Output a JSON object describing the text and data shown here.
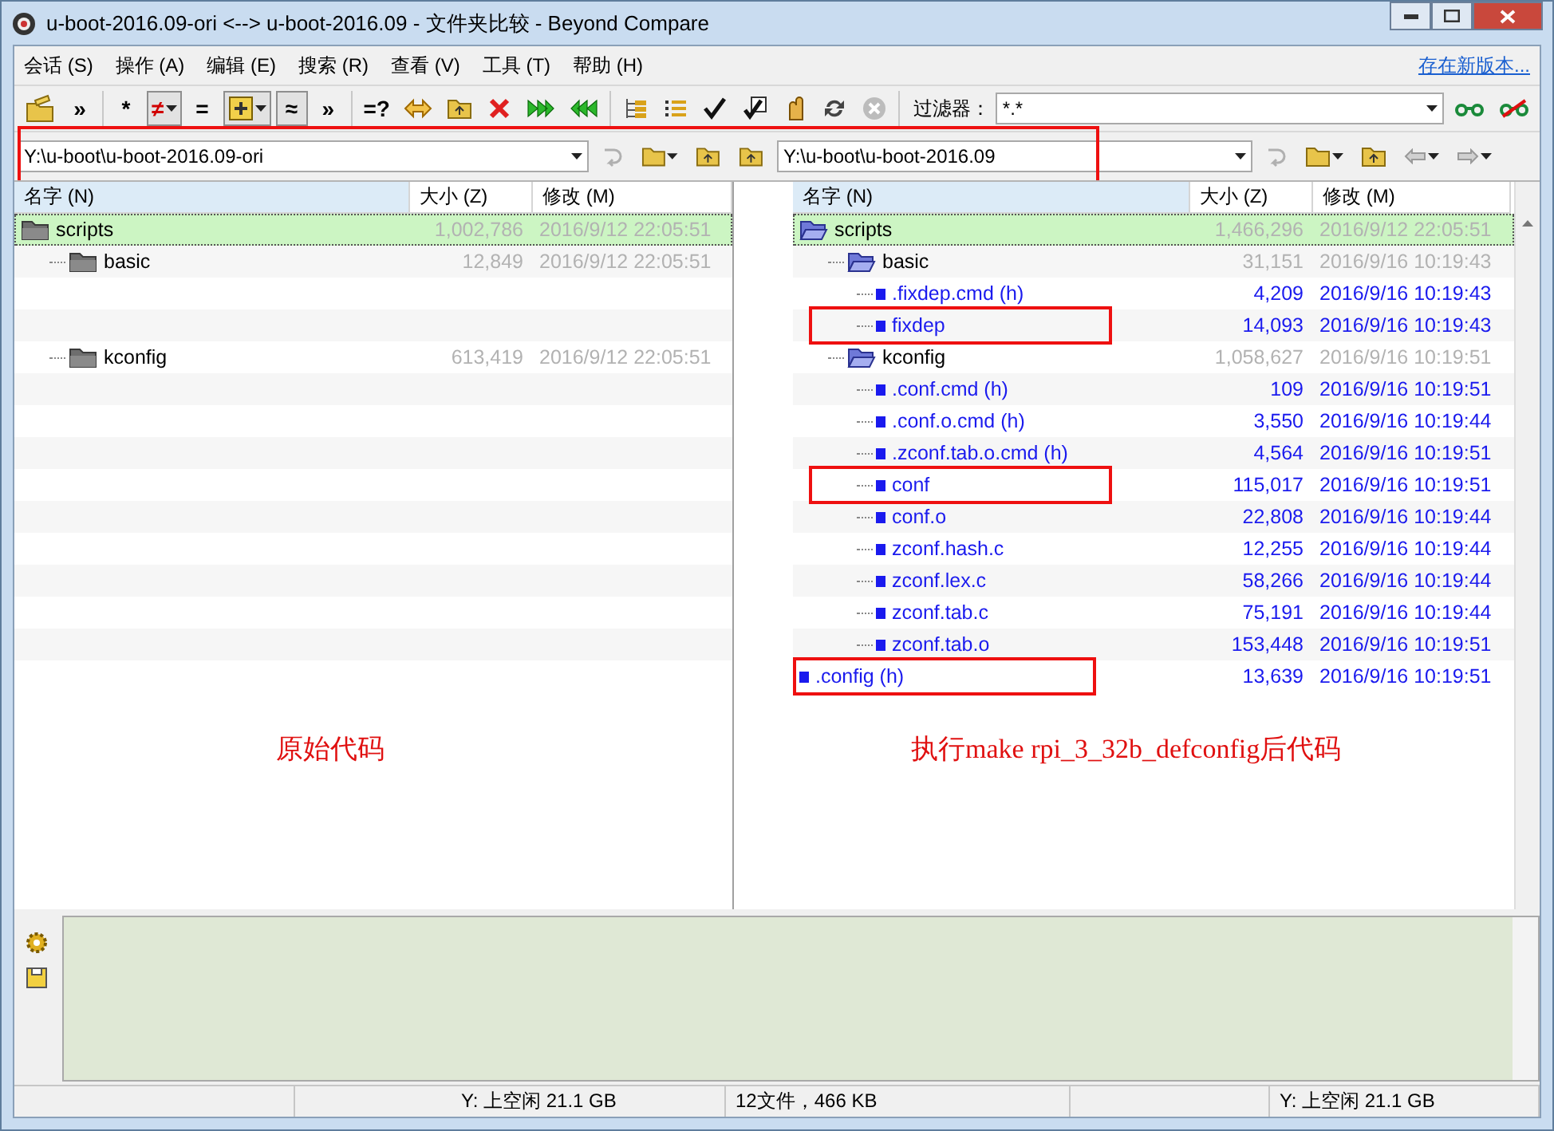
{
  "window": {
    "title": "u-boot-2016.09-ori <--> u-boot-2016.09 - 文件夹比较 - Beyond Compare"
  },
  "menu": {
    "items": [
      {
        "label": "会话 (S)"
      },
      {
        "label": "操作 (A)"
      },
      {
        "label": "编辑 (E)"
      },
      {
        "label": "搜索 (R)"
      },
      {
        "label": "查看 (V)"
      },
      {
        "label": "工具 (T)"
      },
      {
        "label": "帮助 (H)"
      }
    ],
    "link": "存在新版本..."
  },
  "toolbar": {
    "groups": [
      [
        {
          "kind": "icon"
        },
        {
          "kind": "text",
          "label": "»"
        }
      ],
      [
        {
          "kind": "text",
          "label": "*",
          "pressed": false
        },
        {
          "kind": "text",
          "label": "≠",
          "pressed": true,
          "has_menu": true
        },
        {
          "kind": "text",
          "label": "=",
          "pressed": false
        },
        {
          "kind": "icon",
          "pressed": true,
          "has_menu": true
        },
        {
          "kind": "text",
          "label": "≈",
          "pressed": true
        },
        {
          "kind": "text",
          "label": "»"
        }
      ],
      [
        {
          "kind": "text",
          "label": "=?"
        },
        {
          "kind": "icon"
        },
        {
          "kind": "icon"
        },
        {
          "kind": "icon"
        },
        {
          "kind": "icon"
        },
        {
          "kind": "icon"
        }
      ],
      [
        {
          "kind": "icon"
        },
        {
          "kind": "icon"
        },
        {
          "kind": "icon"
        },
        {
          "kind": "icon"
        },
        {
          "kind": "icon"
        },
        {
          "kind": "icon"
        },
        {
          "kind": "icon"
        }
      ]
    ],
    "filter": {
      "label": "过滤器：",
      "value": "*.*"
    }
  },
  "paths": {
    "highlighted": true,
    "left": "Y:\\u-boot\\u-boot-2016.09-ori",
    "right": "Y:\\u-boot\\u-boot-2016.09"
  },
  "left": {
    "columns": [
      {
        "label": "名字 (N)",
        "sorted": true
      },
      {
        "label": "大小 (Z)",
        "sorted": false
      },
      {
        "label": "修改 (M)",
        "sorted": false
      }
    ],
    "items": [
      {
        "kind": "folder",
        "name": "scripts",
        "size": "1,002,786",
        "modified": "2016/9/12 22:05:51",
        "selected": true,
        "children": [
          {
            "kind": "folder",
            "name": "basic",
            "size": "12,849",
            "modified": "2016/9/12 22:05:51",
            "selected": false,
            "children": [
              {
                "kind": "missing"
              },
              {
                "kind": "missing"
              }
            ]
          },
          {
            "kind": "folder",
            "name": "kconfig",
            "size": "613,419",
            "modified": "2016/9/12 22:05:51",
            "selected": false,
            "children": [
              {
                "kind": "missing"
              },
              {
                "kind": "missing"
              },
              {
                "kind": "missing"
              },
              {
                "kind": "missing"
              },
              {
                "kind": "missing"
              },
              {
                "kind": "missing"
              },
              {
                "kind": "missing"
              },
              {
                "kind": "missing"
              },
              {
                "kind": "missing"
              }
            ]
          }
        ]
      },
      {
        "kind": "missing"
      }
    ]
  },
  "right": {
    "columns": [
      {
        "label": "名字 (N)",
        "sorted": true
      },
      {
        "label": "大小 (Z)",
        "sorted": false
      },
      {
        "label": "修改 (M)",
        "sorted": false
      }
    ],
    "items": [
      {
        "kind": "open-folder",
        "name": "scripts",
        "size": "1,466,296",
        "modified": "2016/9/12 22:05:51",
        "selected": true,
        "highlighted": false,
        "children": [
          {
            "kind": "open-folder",
            "name": "basic",
            "size": "31,151",
            "modified": "2016/9/16 10:19:43",
            "selected": false,
            "highlighted": false,
            "children": [
              {
                "kind": "file",
                "name": ".fixdep.cmd (h)",
                "size": "4,209",
                "modified": "2016/9/16 10:19:43",
                "selected": false,
                "highlighted": false
              },
              {
                "kind": "file",
                "name": "fixdep",
                "size": "14,093",
                "modified": "2016/9/16 10:19:43",
                "selected": false,
                "highlighted": true
              }
            ]
          },
          {
            "kind": "open-folder",
            "name": "kconfig",
            "size": "1,058,627",
            "modified": "2016/9/16 10:19:51",
            "selected": false,
            "highlighted": false,
            "children": [
              {
                "kind": "file",
                "name": ".conf.cmd (h)",
                "size": "109",
                "modified": "2016/9/16 10:19:51",
                "selected": false,
                "highlighted": false
              },
              {
                "kind": "file",
                "name": ".conf.o.cmd (h)",
                "size": "3,550",
                "modified": "2016/9/16 10:19:44",
                "selected": false,
                "highlighted": false
              },
              {
                "kind": "file",
                "name": ".zconf.tab.o.cmd (h)",
                "size": "4,564",
                "modified": "2016/9/16 10:19:51",
                "selected": false,
                "highlighted": false
              },
              {
                "kind": "file",
                "name": "conf",
                "size": "115,017",
                "modified": "2016/9/16 10:19:51",
                "selected": false,
                "highlighted": true
              },
              {
                "kind": "file",
                "name": "conf.o",
                "size": "22,808",
                "modified": "2016/9/16 10:19:44",
                "selected": false,
                "highlighted": false
              },
              {
                "kind": "file",
                "name": "zconf.hash.c",
                "size": "12,255",
                "modified": "2016/9/16 10:19:44",
                "selected": false,
                "highlighted": false
              },
              {
                "kind": "file",
                "name": "zconf.lex.c",
                "size": "58,266",
                "modified": "2016/9/16 10:19:44",
                "selected": false,
                "highlighted": false
              },
              {
                "kind": "file",
                "name": "zconf.tab.c",
                "size": "75,191",
                "modified": "2016/9/16 10:19:44",
                "selected": false,
                "highlighted": false
              },
              {
                "kind": "file",
                "name": "zconf.tab.o",
                "size": "153,448",
                "modified": "2016/9/16 10:19:51",
                "selected": false,
                "highlighted": false
              }
            ]
          }
        ]
      },
      {
        "kind": "file",
        "name": ".config (h)",
        "size": "13,639",
        "modified": "2016/9/16 10:19:51",
        "selected": false,
        "highlighted": true
      }
    ]
  },
  "annotations": [
    {
      "text": "原始代码"
    },
    {
      "text": "执行make rpi_3_32b_defconfig后代码"
    }
  ],
  "status_bar": [
    {
      "text": "Y: 上空闲 21.1 GB"
    },
    {
      "text": "12文件，466 KB"
    },
    {
      "text": "Y: 上空闲 21.1 GB"
    }
  ]
}
